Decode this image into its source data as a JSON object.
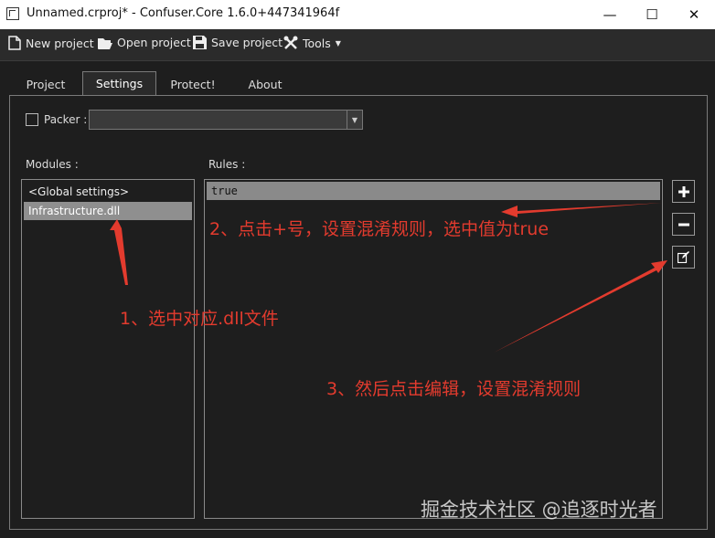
{
  "window": {
    "title": "Unnamed.crproj* - Confuser.Core 1.6.0+447341964f",
    "minimize": "—",
    "maximize": "☐",
    "close": "✕"
  },
  "toolbar": {
    "new_project": "New project",
    "open_project": "Open project",
    "save_project": "Save project",
    "tools": "Tools"
  },
  "tabs": [
    {
      "label": "Project"
    },
    {
      "label": "Settings",
      "active": true
    },
    {
      "label": "Protect!"
    },
    {
      "label": "About"
    }
  ],
  "settings": {
    "packer_label": "Packer :",
    "packer_value": "",
    "modules_label": "Modules :",
    "rules_label": "Rules :",
    "modules": [
      "<Global settings>",
      "Infrastructure.dll"
    ],
    "rules": [
      "true"
    ]
  },
  "annotations": {
    "step1": "1、选中对应.dll文件",
    "step2": "2、点击+号，设置混淆规则，选中值为true",
    "step3": "3、然后点击编辑，设置混淆规则"
  },
  "watermark": "掘金技术社区 @追逐时光者",
  "colors": {
    "background": "#1e1e1e",
    "selection": "#8f8f8f",
    "annotation": "#e33b2e"
  }
}
